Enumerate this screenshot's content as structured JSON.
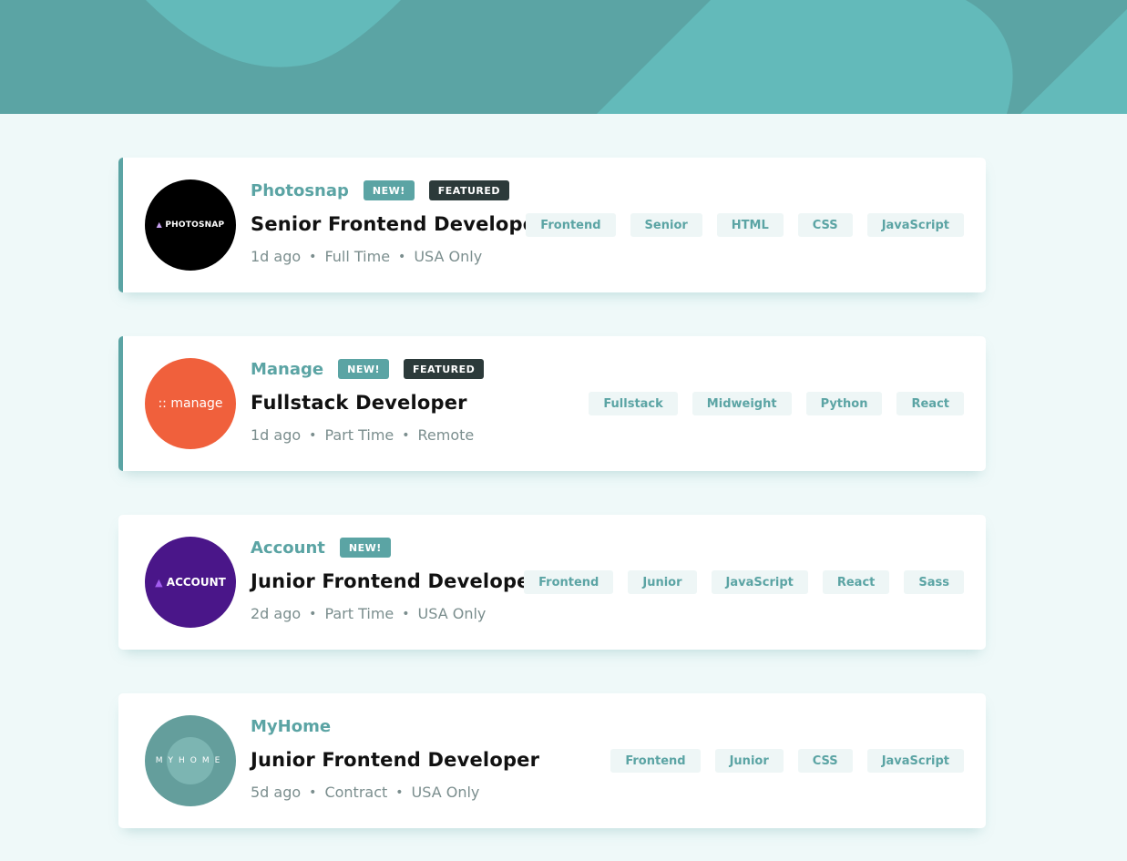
{
  "theme": {
    "accent": "#5ba4a4",
    "background": "#eff9f9",
    "featured_badge": "#2c3a3a",
    "tag_bg": "#eef6f6"
  },
  "jobs": [
    {
      "company": "Photosnap",
      "logo": {
        "text": "PHOTOSNAP",
        "bg": "#000000",
        "icon": "triangle-icon"
      },
      "new_label": "NEW!",
      "featured_label": "FEATURED",
      "position": "Senior Frontend Developer",
      "posted": "1d ago",
      "contract": "Full Time",
      "location": "USA Only",
      "tags": [
        "Frontend",
        "Senior",
        "HTML",
        "CSS",
        "JavaScript"
      ]
    },
    {
      "company": "Manage",
      "logo": {
        "text": ":: manage",
        "bg": "#f0603c"
      },
      "new_label": "NEW!",
      "featured_label": "FEATURED",
      "position": "Fullstack Developer",
      "posted": "1d ago",
      "contract": "Part Time",
      "location": "Remote",
      "tags": [
        "Fullstack",
        "Midweight",
        "Python",
        "React"
      ]
    },
    {
      "company": "Account",
      "logo": {
        "text": "ACCOUNT",
        "bg": "#4a1689",
        "icon": "mountain-icon"
      },
      "new_label": "NEW!",
      "position": "Junior Frontend Developer",
      "posted": "2d ago",
      "contract": "Part Time",
      "location": "USA Only",
      "tags": [
        "Frontend",
        "Junior",
        "JavaScript",
        "React",
        "Sass"
      ]
    },
    {
      "company": "MyHome",
      "logo": {
        "text": "MYHOME",
        "bg": "#649e9c"
      },
      "position": "Junior Frontend Developer",
      "posted": "5d ago",
      "contract": "Contract",
      "location": "USA Only",
      "tags": [
        "Frontend",
        "Junior",
        "CSS",
        "JavaScript"
      ]
    }
  ]
}
